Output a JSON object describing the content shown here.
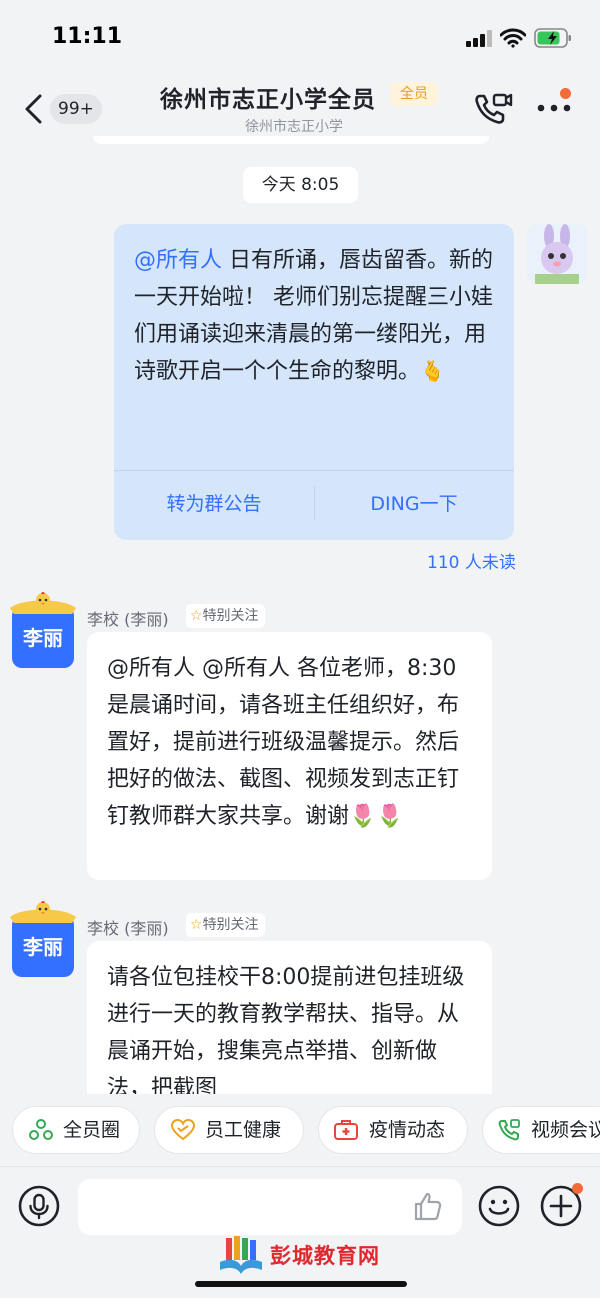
{
  "status_bar": {
    "time": "11:11"
  },
  "header": {
    "back_count": "99+",
    "title": "徐州市志正小学全员",
    "title_tag": "全员",
    "subtitle": "徐州市志正小学"
  },
  "timestamp": "今天 8:05",
  "my_message": {
    "mention": "@所有人",
    "text": " 日有所诵，唇齿留香。新的一天开始啦！ 老师们别忘提醒三小娃们用诵读迎来清晨的第一缕阳光，用诗歌开启一个个生命的黎明。",
    "emoji": "🫰",
    "action_announce": "转为群公告",
    "action_ding": "DING一下",
    "unread": "110 人未读"
  },
  "messages": [
    {
      "avatar_text": "李丽",
      "sender": "李校 (李丽)",
      "tag": "特别关注",
      "text": "@所有人 @所有人 各位老师，8:30是晨诵时间，请各班主任组织好，布置好，提前进行班级温馨提示。然后把好的做法、截图、视频发到志正钉钉教师群大家共享。谢谢🌷🌷"
    },
    {
      "avatar_text": "李丽",
      "sender": "李校 (李丽)",
      "tag": "特别关注",
      "text": "请各位包挂校干8:00提前进包挂班级进行一天的教育教学帮扶、指导。从晨诵开始，搜集亮点举措、创新做法，把截图"
    }
  ],
  "quick_actions": [
    {
      "label": "全员圈",
      "icon": "circle-group-icon",
      "color": "#34a853"
    },
    {
      "label": "员工健康",
      "icon": "heart-icon",
      "color": "#f0a020"
    },
    {
      "label": "疫情动态",
      "icon": "medical-kit-icon",
      "color": "#e8453c"
    },
    {
      "label": "视频会议",
      "icon": "video-phone-icon",
      "color": "#34a853"
    }
  ],
  "watermark": "彭城教育网",
  "colors": {
    "accent": "#3370ff",
    "my_bubble": "#d5e6fb",
    "notify_dot": "#f26b3a"
  }
}
